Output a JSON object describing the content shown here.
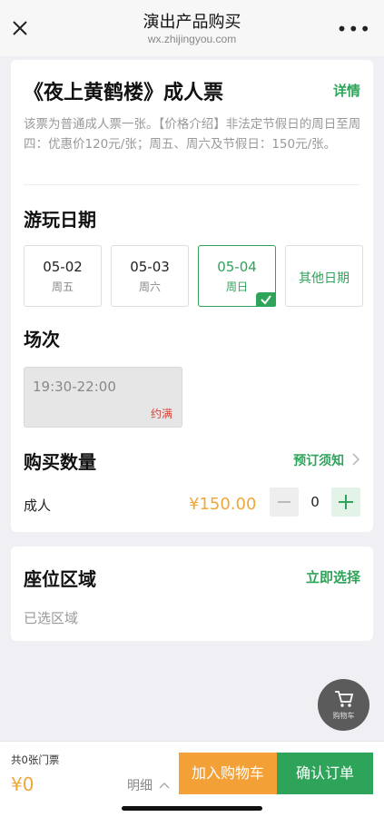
{
  "header": {
    "title": "演出产品购买",
    "subtitle": "wx.zhijingyou.com"
  },
  "product": {
    "name": "《夜上黄鹤楼》成人票",
    "detail_link": "详情",
    "description": "该票为普通成人票一张。【价格介绍】非法定节假日的周日至周四：优惠价120元/张；周五、周六及节假日：150元/张。"
  },
  "date_section": {
    "title": "游玩日期",
    "dates": [
      {
        "date": "05-02",
        "weekday": "周五"
      },
      {
        "date": "05-03",
        "weekday": "周六"
      },
      {
        "date": "05-04",
        "weekday": "周日"
      }
    ],
    "selected_index": 2,
    "other_dates_label": "其他日期"
  },
  "session_section": {
    "title": "场次",
    "session_time": "19:30-22:00",
    "session_status": "约满"
  },
  "quantity_section": {
    "title": "购买数量",
    "notice_link": "预订须知",
    "ticket_type": "成人",
    "price": "¥150.00",
    "quantity": "0"
  },
  "seat_section": {
    "title": "座位区域",
    "select_link": "立即选择",
    "selected_placeholder": "已选区域"
  },
  "floating_cart": {
    "label": "购物车"
  },
  "footer": {
    "ticket_count": "共0张门票",
    "total": "¥0",
    "breakdown": "明细",
    "add_to_cart": "加入购物车",
    "confirm": "确认订单"
  },
  "colors": {
    "accent": "#2ea35a",
    "price": "#f0a73a",
    "sold_out": "#d0453b"
  },
  "icons": [
    "close-icon",
    "more-icon",
    "checkmark-icon",
    "chevron-right-icon",
    "chevron-up-icon",
    "cart-icon"
  ]
}
